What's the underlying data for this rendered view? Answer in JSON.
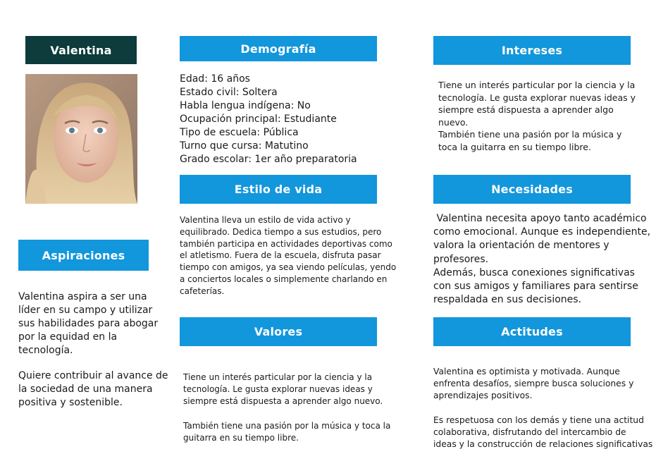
{
  "persona": {
    "name": "Valentina"
  },
  "demografia": {
    "title": "Demografía",
    "lines": [
      "Edad: 16 años",
      "Estado civil: Soltera",
      "Habla lengua indígena: No",
      "Ocupación principal: Estudiante",
      "Tipo de escuela: Pública",
      "Turno que cursa:  Matutino",
      "Grado escolar: 1er año preparatoria"
    ]
  },
  "intereses": {
    "title": "Intereses",
    "lines": [
      "Tiene un interés particular por la ciencia y la",
      "tecnología. Le gusta explorar nuevas ideas y",
      "siempre está dispuesta a aprender algo",
      "nuevo.",
      "También tiene una pasión por la música y",
      "toca la guitarra en su tiempo libre."
    ]
  },
  "estilo_de_vida": {
    "title": "Estilo de vida",
    "lines": [
      "Valentina lleva un estilo de vida activo y",
      "equilibrado. Dedica tiempo a sus estudios, pero",
      "también participa en actividades deportivas como",
      "el atletismo. Fuera de la escuela, disfruta pasar",
      "tiempo con amigos, ya sea viendo películas, yendo",
      "a conciertos locales o simplemente charlando en",
      "cafeterías."
    ]
  },
  "necesidades": {
    "title": "Necesidades",
    "lines": [
      " Valentina necesita apoyo tanto académico",
      "como emocional. Aunque es independiente,",
      "valora la orientación de mentores y",
      "profesores.",
      "Además, busca conexiones significativas",
      "con sus amigos y familiares para sentirse",
      "respaldada en sus decisiones."
    ]
  },
  "aspiraciones": {
    "title": "Aspiraciones",
    "lines": [
      "Valentina aspira a ser una",
      "líder en su campo y utilizar",
      "sus habilidades para abogar",
      "por la equidad en la",
      "tecnología.",
      "",
      "Quiere contribuir al avance de",
      "la sociedad de una manera",
      "positiva y sostenible."
    ]
  },
  "valores": {
    "title": "Valores",
    "lines": [
      "Tiene un interés particular por la ciencia y la",
      "tecnología. Le gusta explorar nuevas ideas y",
      "siempre está dispuesta a aprender algo nuevo.",
      "",
      "También tiene una pasión por la música y toca la",
      "guitarra en su tiempo libre."
    ]
  },
  "actitudes": {
    "title": "Actitudes",
    "lines": [
      "Valentina es optimista y motivada. Aunque",
      "enfrenta desafíos, siempre busca soluciones y",
      "aprendizajes positivos.",
      "",
      "Es respetuosa con los demás y tiene una actitud",
      "colaborativa, disfrutando del intercambio de",
      "ideas y la construcción de relaciones significativas"
    ]
  },
  "colors": {
    "header_blue": "#1296dc",
    "name_bg": "#0e3b3c"
  }
}
